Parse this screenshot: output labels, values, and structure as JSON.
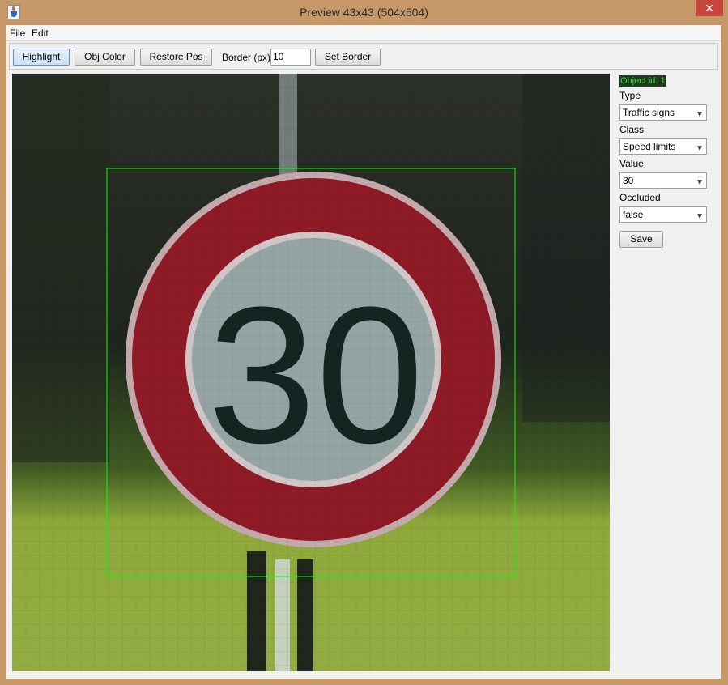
{
  "window": {
    "title": "Preview 43x43 (504x504)",
    "close_symbol": "✕"
  },
  "menu": {
    "items": [
      "File",
      "Edit"
    ]
  },
  "toolbar": {
    "highlight_label": "Highlight",
    "obj_color_label": "Obj Color",
    "restore_pos_label": "Restore Pos",
    "border_label": "Border (px)",
    "border_value": "10",
    "set_border_label": "Set Border"
  },
  "sidebar": {
    "object_id": "Object id: 1",
    "type_label": "Type",
    "type_value": "Traffic signs",
    "class_label": "Class",
    "class_value": "Speed limits",
    "value_label": "Value",
    "value_value": "30",
    "occluded_label": "Occluded",
    "occluded_value": "false",
    "save_label": "Save"
  },
  "image": {
    "sign_text": "30",
    "highlight_color": "#00ff00"
  },
  "colors": {
    "titlebar": "#c79867",
    "close": "#c7463c",
    "sign_red": "#8e1a26",
    "sign_face": "#93a4a3"
  }
}
